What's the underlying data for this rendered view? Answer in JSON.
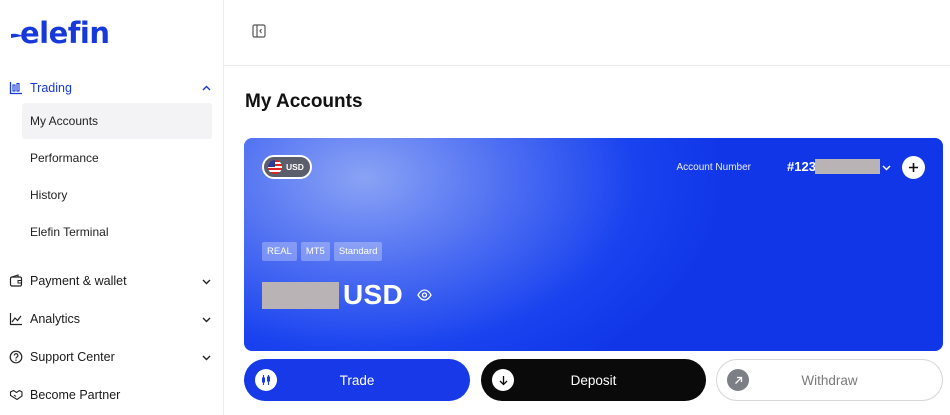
{
  "brand": {
    "logo_text": "elefin",
    "color": "#1739d9"
  },
  "sidebar": {
    "trading": {
      "label": "Trading",
      "icon": "chart-bars-icon",
      "expanded": true,
      "items": [
        {
          "label": "My Accounts",
          "selected": true
        },
        {
          "label": "Performance"
        },
        {
          "label": "History"
        },
        {
          "label": "Elefin Terminal"
        }
      ]
    },
    "groups": [
      {
        "label": "Payment & wallet",
        "icon": "wallet-icon"
      },
      {
        "label": "Analytics",
        "icon": "line-chart-icon"
      },
      {
        "label": "Support Center",
        "icon": "help-circle-icon"
      },
      {
        "label": "Become Partner",
        "icon": "handshake-icon"
      }
    ]
  },
  "topbar": {
    "collapse_icon": "sidebar-collapse-icon"
  },
  "main": {
    "title": "My Accounts",
    "account_card": {
      "currency_badge": "USD",
      "account_number_label": "Account Number",
      "account_number_prefix": "#123",
      "tags": [
        "REAL",
        "MT5",
        "Standard"
      ],
      "balance_currency": "USD",
      "gradient_colors": [
        "#8aa3f5",
        "#1036e8"
      ]
    },
    "actions": {
      "trade": "Trade",
      "deposit": "Deposit",
      "withdraw": "Withdraw"
    }
  }
}
